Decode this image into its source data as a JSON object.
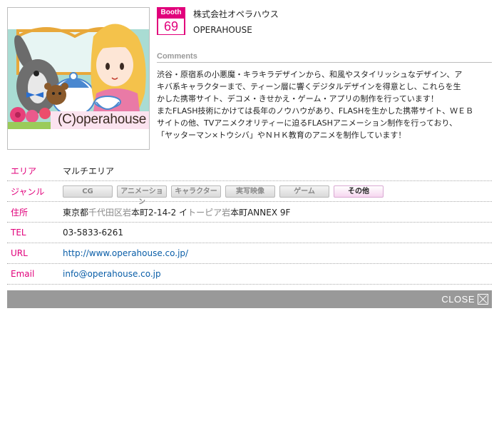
{
  "booth": {
    "label": "Booth",
    "number": "69"
  },
  "company": {
    "name_jp": "株式会社オペラハウス",
    "name_en": "OPERAHOUSE"
  },
  "image": {
    "credit": "(C)operahouse"
  },
  "comments": {
    "heading": "Comments",
    "lines": [
      "渋谷・原宿系の小悪魔・キラキラデザインから、和風やスタイリッシュなデザイン、ア",
      "キバ系キャラクターまで、ティーン層に響くデジタルデザインを得意とし、これらを生",
      "かした携帯サイト、デコメ・きせかえ・ゲーム・アプリの制作を行っています！",
      "またFLASH技術にかけては長年のノウハウがあり、FLASHを生かした携帯サイト、ＷＥＢ",
      "サイトの他、TVアニメクオリティーに迫るFLASHアニメーション制作を行っており、",
      "「ヤッターマン×トウシバ」やＮＨＫ教育のアニメを制作しています！"
    ]
  },
  "info": {
    "area": {
      "label": "エリア",
      "value": "マルチエリア"
    },
    "genre": {
      "label": "ジャンル",
      "tags": [
        {
          "label": "CG",
          "active": false
        },
        {
          "label": "アニメーション",
          "active": false
        },
        {
          "label": "キャラクター",
          "active": false
        },
        {
          "label": "実写映像",
          "active": false
        },
        {
          "label": "ゲーム",
          "active": false
        },
        {
          "label": "その他",
          "active": true
        }
      ]
    },
    "address": {
      "label": "住所",
      "parts": [
        "東京都",
        "千代田区",
        "岩",
        "本町2-14-2 イ",
        "トーピア",
        "岩",
        "本町ANNEX 9F"
      ]
    },
    "tel": {
      "label": "TEL",
      "value": "03-5833-6261"
    },
    "url": {
      "label": "URL",
      "value": "http://www.operahouse.co.jp/"
    },
    "email": {
      "label": "Email",
      "value": "info@operahouse.co.jp"
    }
  },
  "close": {
    "label": "CLOSE"
  },
  "colors": {
    "accent": "#e1007b",
    "link": "#0a5ea8",
    "close_bar": "#999999"
  }
}
